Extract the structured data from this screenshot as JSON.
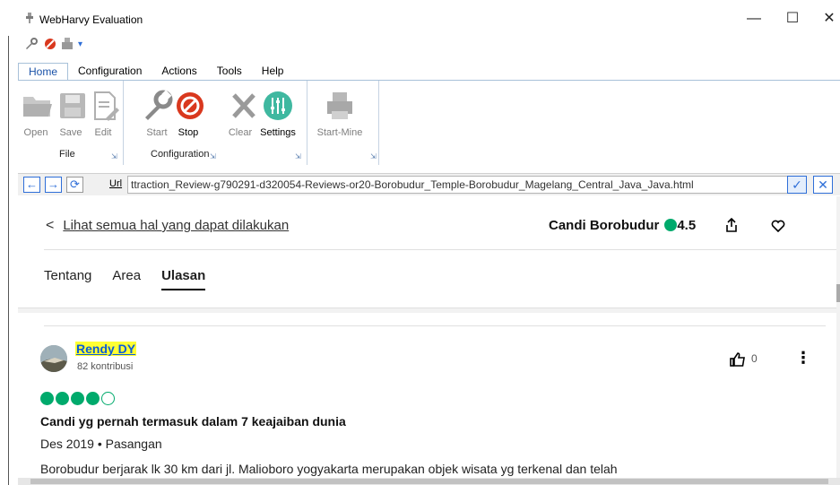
{
  "window": {
    "title": "WebHarvy Evaluation",
    "minimize_icon": "minimize-icon",
    "maximize_icon": "maximize-icon",
    "close_icon": "close-icon",
    "min_glyph": "—",
    "max_glyph": "☐",
    "close_glyph": "✕"
  },
  "quick_access": {
    "dropdown_glyph": "▾"
  },
  "menu": {
    "tabs": [
      "Home",
      "Configuration",
      "Actions",
      "Tools",
      "Help"
    ],
    "active": "Home"
  },
  "ribbon": {
    "file_group": {
      "label": "File",
      "buttons": [
        "Open",
        "Save",
        "Edit"
      ]
    },
    "config_group": {
      "label": "Configuration",
      "buttons": [
        "Start",
        "Stop",
        "Clear",
        "Settings"
      ]
    },
    "mine_group": {
      "buttons": [
        "Start-Mine"
      ]
    },
    "launcher_glyph": "⇲"
  },
  "urlbar": {
    "back_glyph": "←",
    "forward_glyph": "→",
    "refresh_glyph": "⟳",
    "label": "Url",
    "value": "ttraction_Review-g790291-d320054-Reviews-or20-Borobudur_Temple-Borobudur_Magelang_Central_Java_Java.html",
    "go_glyph": "✓",
    "stop_glyph": "✕"
  },
  "page": {
    "back_chevron": "<",
    "back_link": "Lihat semua hal yang dapat dilakukan",
    "attraction_name": "Candi Borobudur",
    "rating": "4.5",
    "tabs": [
      "Tentang",
      "Area",
      "Ulasan"
    ],
    "active_tab": "Ulasan"
  },
  "review": {
    "reviewer": "Rendy DY",
    "contributions": "82 kontribusi",
    "likes": "0",
    "more_glyph": "⋮",
    "bubble_rating": 4,
    "bubble_max": 5,
    "title": "Candi yg pernah termasuk dalam 7 keajaiban dunia",
    "meta": "Des 2019 • Pasangan",
    "body": "Borobudur berjarak lk 30 km dari jl. Malioboro yogyakarta merupakan objek wisata yg terkenal dan telah"
  },
  "colors": {
    "accent_blue": "#2f6fd8",
    "rating_green": "#00aa6c",
    "highlight_yellow": "#ffff33",
    "settings_teal": "#3fb8a0",
    "stop_red": "#d9381e"
  }
}
